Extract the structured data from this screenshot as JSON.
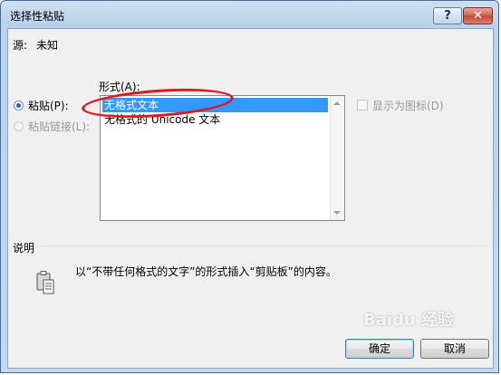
{
  "window": {
    "title": "选择性粘贴",
    "help_label": "?",
    "close_label": "✕"
  },
  "source": {
    "label": "源:",
    "value": "未知"
  },
  "format": {
    "label": "形式(A):",
    "items": [
      "无格式文本",
      "无格式的 Unicode 文本"
    ],
    "selected_index": 0
  },
  "options": {
    "paste_label": "粘贴(P):",
    "paste_link_label": "粘贴链接(L):",
    "display_as_icon_label": "显示为图标(D)"
  },
  "description": {
    "label": "说明",
    "text": "以“不带任何格式的文字”的形式插入“剪贴板”的内容。"
  },
  "buttons": {
    "ok_label": "确定",
    "cancel_label": "取消"
  },
  "watermark": {
    "text": "Baidu 经验"
  },
  "colors": {
    "selection": "#3399ff",
    "annotation": "#e3181c"
  }
}
